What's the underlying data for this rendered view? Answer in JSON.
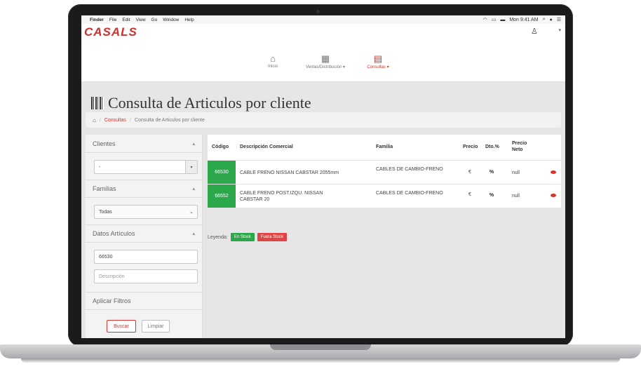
{
  "menubar": {
    "apple": "",
    "items": [
      "Finder",
      "File",
      "Edit",
      "View",
      "Go",
      "Window",
      "Help"
    ],
    "clock": "Mon 9:41 AM"
  },
  "header": {
    "logo": "CASALS"
  },
  "nav": [
    {
      "label": "Inicio",
      "icon": "home-icon"
    },
    {
      "label": "Ventas/Distribución ▾",
      "icon": "table-icon"
    },
    {
      "label": "Consultas ▾",
      "icon": "barcode-icon"
    }
  ],
  "page": {
    "title": "Consulta de Articulos por cliente",
    "breadcrumb": {
      "link": "Consultas",
      "current": "Consulta de Articulos por cliente"
    }
  },
  "filters": {
    "clientes": {
      "label": "Clientes",
      "value": "-"
    },
    "familias": {
      "label": "Familias",
      "value": "Todas"
    },
    "datos": {
      "label": "Datos Artículos",
      "code_value": "66530",
      "description_placeholder": "Descripción"
    },
    "apply_label": "Aplicar Filtros",
    "search_label": "Buscar",
    "clear_label": "Limpiar"
  },
  "table": {
    "headers": {
      "codigo": "Código",
      "descripcion": "Descripción Comercial",
      "familia": "Familia",
      "precio": "Precio",
      "dto": "Dto.%",
      "neto": "Precio Neto"
    },
    "rows": [
      {
        "code": "66530",
        "description": "CABLE FRENO NISSAN CABSTAR 2055mm",
        "family": "CABLES DE CAMBIO-FRENO",
        "price": "€",
        "dto": "%",
        "neto": "null"
      },
      {
        "code": "66552",
        "description": "CABLE FRENO POST.IZQU. NISSAN CABSTAR 20",
        "family": "CABLES DE CAMBIO-FRENO",
        "price": "€",
        "dto": "%",
        "neto": "null"
      }
    ]
  },
  "legend": {
    "label": "Leyenda:",
    "in_stock": "En Stock",
    "out_stock": "Fuera Stock"
  },
  "colors": {
    "brand": "#d9342b",
    "stock_green": "#2aa84a",
    "stock_red": "#e04545"
  }
}
